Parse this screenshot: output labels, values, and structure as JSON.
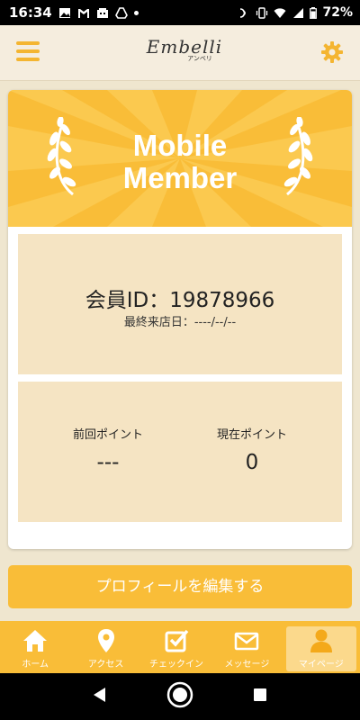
{
  "status_bar": {
    "time": "16:34",
    "battery": "72%"
  },
  "header": {
    "logo_text": "Embelli",
    "logo_sub": "アンベリ",
    "menu_icon": "hamburger-menu-icon",
    "settings_icon": "gear-icon"
  },
  "card": {
    "banner_title_line1": "Mobile",
    "banner_title_line2": "Member",
    "member_id_text": "会員ID：19878966",
    "last_visit_text": "最終来店日：----/--/--",
    "previous_points_label": "前回ポイント",
    "previous_points_value": "---",
    "current_points_label": "現在ポイント",
    "current_points_value": "0"
  },
  "edit_profile_label": "プロフィールを編集する",
  "bottom_nav": {
    "items": [
      {
        "label": "ホーム",
        "icon": "home-icon"
      },
      {
        "label": "アクセス",
        "icon": "map-pin-icon"
      },
      {
        "label": "チェックイン",
        "icon": "checkbox-icon"
      },
      {
        "label": "メッセージ",
        "icon": "envelope-icon"
      },
      {
        "label": "マイページ",
        "icon": "person-icon"
      }
    ],
    "active_index": 4
  },
  "colors": {
    "accent": "#f9bd38",
    "panel": "#f5e4c3",
    "background": "#efe6cf"
  }
}
